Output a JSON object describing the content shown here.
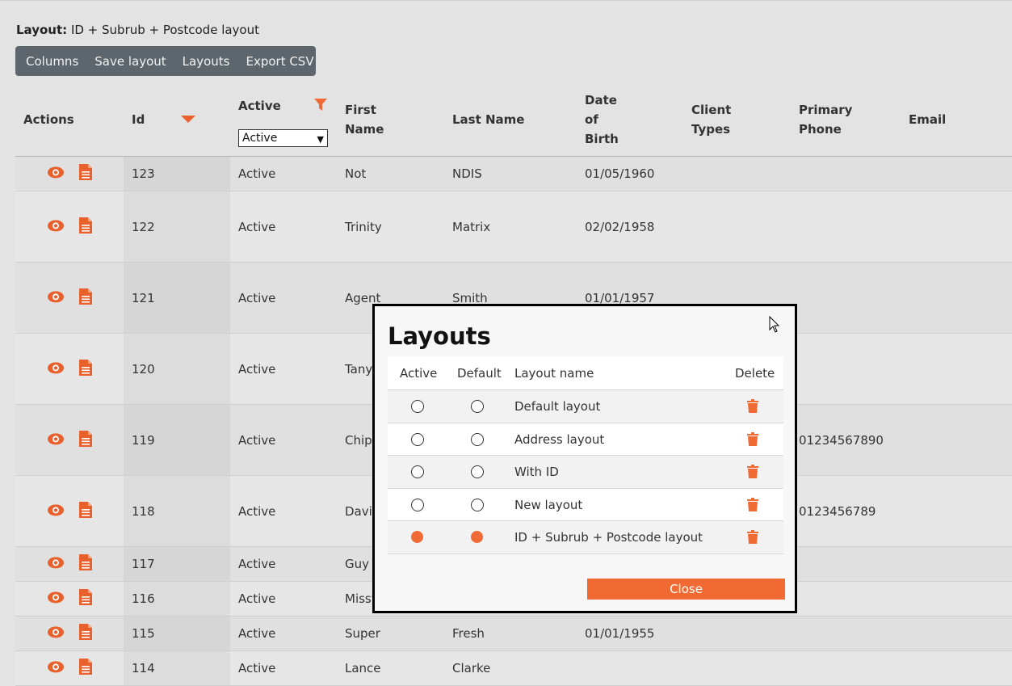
{
  "layout_label": {
    "prefix": "Layout:",
    "value": "ID + Subrub + Postcode layout"
  },
  "toolbar": {
    "buttons": [
      "Columns",
      "Save layout",
      "Layouts",
      "Export CSV"
    ]
  },
  "table": {
    "headers": {
      "actions": "Actions",
      "id": "Id",
      "active": "Active",
      "first_name": [
        "First",
        "Name"
      ],
      "last_name": "Last Name",
      "dob": [
        "Date",
        "of",
        "Birth"
      ],
      "client_types": [
        "Client",
        "Types"
      ],
      "primary_phone": [
        "Primary",
        "Phone"
      ],
      "email": "Email"
    },
    "active_filter": {
      "selected": "Active"
    },
    "rows": [
      {
        "id": "123",
        "active": "Active",
        "first": "Not",
        "last": "NDIS",
        "dob": "01/05/1960",
        "phone": ""
      },
      {
        "id": "122",
        "active": "Active",
        "first": "Trinity",
        "last": "Matrix",
        "dob": "02/02/1958",
        "phone": ""
      },
      {
        "id": "121",
        "active": "Active",
        "first": "Agent",
        "last": "Smith",
        "dob": "01/01/1957",
        "phone": ""
      },
      {
        "id": "120",
        "active": "Active",
        "first": "Tanya",
        "last": "",
        "dob": "",
        "phone": ""
      },
      {
        "id": "119",
        "active": "Active",
        "first": "Chip",
        "last": "",
        "dob": "",
        "phone": "01234567890"
      },
      {
        "id": "118",
        "active": "Active",
        "first": "David",
        "last": "",
        "dob": "",
        "phone": "0123456789"
      },
      {
        "id": "117",
        "active": "Active",
        "first": "Guy",
        "last": "",
        "dob": "",
        "phone": ""
      },
      {
        "id": "116",
        "active": "Active",
        "first": "Missy",
        "last": "",
        "dob": "",
        "phone": ""
      },
      {
        "id": "115",
        "active": "Active",
        "first": "Super",
        "last": "Fresh",
        "dob": "01/01/1955",
        "phone": ""
      },
      {
        "id": "114",
        "active": "Active",
        "first": "Lance",
        "last": "Clarke",
        "dob": "",
        "phone": ""
      }
    ]
  },
  "modal": {
    "title": "Layouts",
    "headers": {
      "active": "Active",
      "default": "Default",
      "name": "Layout name",
      "delete": "Delete"
    },
    "layouts": [
      {
        "name": "Default layout",
        "active": false,
        "default": false
      },
      {
        "name": "Address layout",
        "active": false,
        "default": false
      },
      {
        "name": "With ID",
        "active": false,
        "default": false
      },
      {
        "name": "New layout",
        "active": false,
        "default": false
      },
      {
        "name": "ID + Subrub + Postcode layout",
        "active": true,
        "default": true
      }
    ],
    "close_label": "Close"
  },
  "colors": {
    "accent": "#f26a33",
    "toolbar": "#5d666c"
  }
}
